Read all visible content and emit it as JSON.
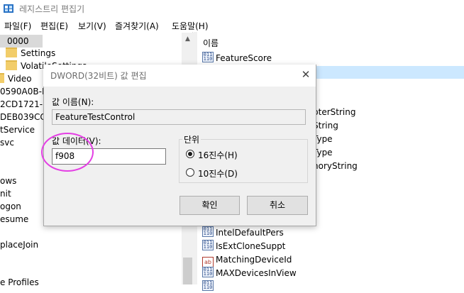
{
  "window": {
    "title": "레지스트리 편집기"
  },
  "menu": [
    "파일(F)",
    "편집(E)",
    "보기(V)",
    "즐겨찾기(A)",
    "도움말(H)"
  ],
  "tree": {
    "items": [
      "0000",
      "Settings",
      "VolatileSettings",
      "Video",
      "0590A0B-D",
      "2CD1721-2",
      "DEB039CC-E",
      "tService",
      "svc",
      "ows",
      "nit",
      "ogon",
      "esume",
      "placeJoin",
      "e Profiles"
    ]
  },
  "list": {
    "column_header": "이름",
    "items": [
      {
        "icon": "binary-value-icon",
        "name": "FeatureScore"
      },
      {
        "icon": "binary-value-icon",
        "name": "FeatureTestControl"
      },
      {
        "icon": "binary-value-icon",
        "name": "pterString"
      },
      {
        "icon": "binary-value-icon",
        "name": "String"
      },
      {
        "icon": "binary-value-icon",
        "name": "Type"
      },
      {
        "icon": "binary-value-icon",
        "name": "Type"
      },
      {
        "icon": "binary-value-icon",
        "name": "noryString"
      },
      {
        "icon": "binary-value-icon",
        "name": "IntelDefaultPers"
      },
      {
        "icon": "binary-value-icon",
        "name": "IsExtCloneSuppt"
      },
      {
        "icon": "string-value-icon",
        "name": "MatchingDeviceId"
      },
      {
        "icon": "binary-value-icon",
        "name": "MAXDevicesInView"
      }
    ]
  },
  "dialog": {
    "title": "DWORD(32비트) 값 편집",
    "close_glyph": "✕",
    "value_name_label": "값 이름(N):",
    "value_name": "FeatureTestControl",
    "value_data_label": "값 데이터(V):",
    "value_data": "f908",
    "base_label": "단위",
    "hex_label": "16진수(H)",
    "dec_label": "10진수(D)",
    "base_selected": "hex",
    "ok_label": "확인",
    "cancel_label": "취소"
  },
  "annotation_color": "#e43fe4"
}
